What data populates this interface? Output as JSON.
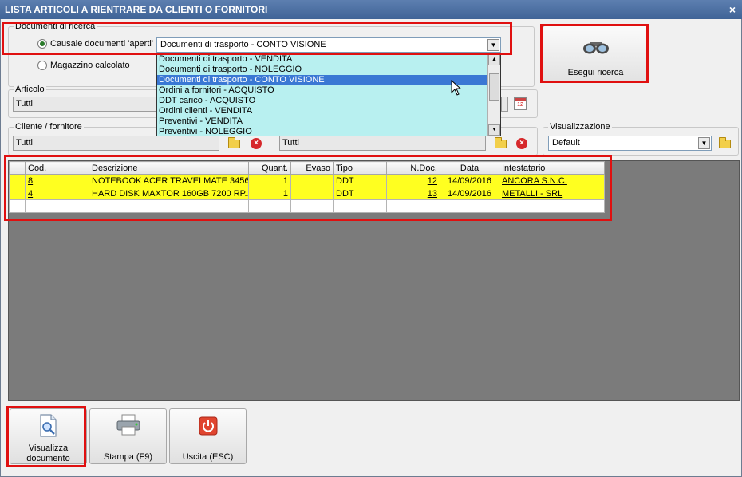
{
  "window": {
    "title": "LISTA ARTICOLI A RIENTRARE DA CLIENTI O FORNITORI",
    "close_glyph": "×"
  },
  "search_docs": {
    "group_label": "Documenti di ricerca",
    "radio_open": "Causale documenti 'aperti'",
    "radio_warehouse": "Magazzino calcolato",
    "selected_causale": "Documenti di trasporto - CONTO VISIONE",
    "dropdown_options": [
      "Documenti di trasporto - VENDITA",
      "Documenti di trasporto - NOLEGGIO",
      "Documenti di trasporto - CONTO VISIONE",
      "Ordini a fornitori - ACQUISTO",
      "DDT carico - ACQUISTO",
      "Ordini clienti - VENDITA",
      "Preventivi - VENDITA",
      "Preventivi - NOLEGGIO"
    ],
    "selected_index": 2
  },
  "search_button": {
    "label": "Esegui ricerca",
    "icon": "binoculars-icon"
  },
  "articolo": {
    "label": "Articolo",
    "value": "Tutti"
  },
  "cliente": {
    "label": "Cliente / fornitore",
    "value": "Tutti"
  },
  "second_field": {
    "value": "Tutti"
  },
  "visualizzazione": {
    "label": "Visualizzazione",
    "value": "Default"
  },
  "grid": {
    "columns": [
      "Cod.",
      "Descrizione",
      "Quant.",
      "Evaso",
      "Tipo",
      "N.Doc.",
      "Data",
      "Intestatario"
    ],
    "rows": [
      {
        "cod": "8",
        "descrizione": "NOTEBOOK ACER TRAVELMATE 3456",
        "quant": "1",
        "evaso": "",
        "tipo": "DDT",
        "ndoc": "12",
        "data": "14/09/2016",
        "intestatario": "ANCORA S.N.C."
      },
      {
        "cod": "4",
        "descrizione": "HARD DISK MAXTOR 160GB 7200 RP...",
        "quant": "1",
        "evaso": "",
        "tipo": "DDT",
        "ndoc": "13",
        "data": "14/09/2016",
        "intestatario": "METALLI - SRL"
      }
    ]
  },
  "buttons": {
    "view_doc_line1": "Visualizza",
    "view_doc_line2": "documento",
    "print": "Stampa (F9)",
    "exit": "Uscita (ESC)"
  },
  "colors": {
    "highlight_row": "#ffff20",
    "dropdown_bg": "#b8f0f0",
    "selection": "#3a78d4",
    "annotation": "#e01010"
  }
}
